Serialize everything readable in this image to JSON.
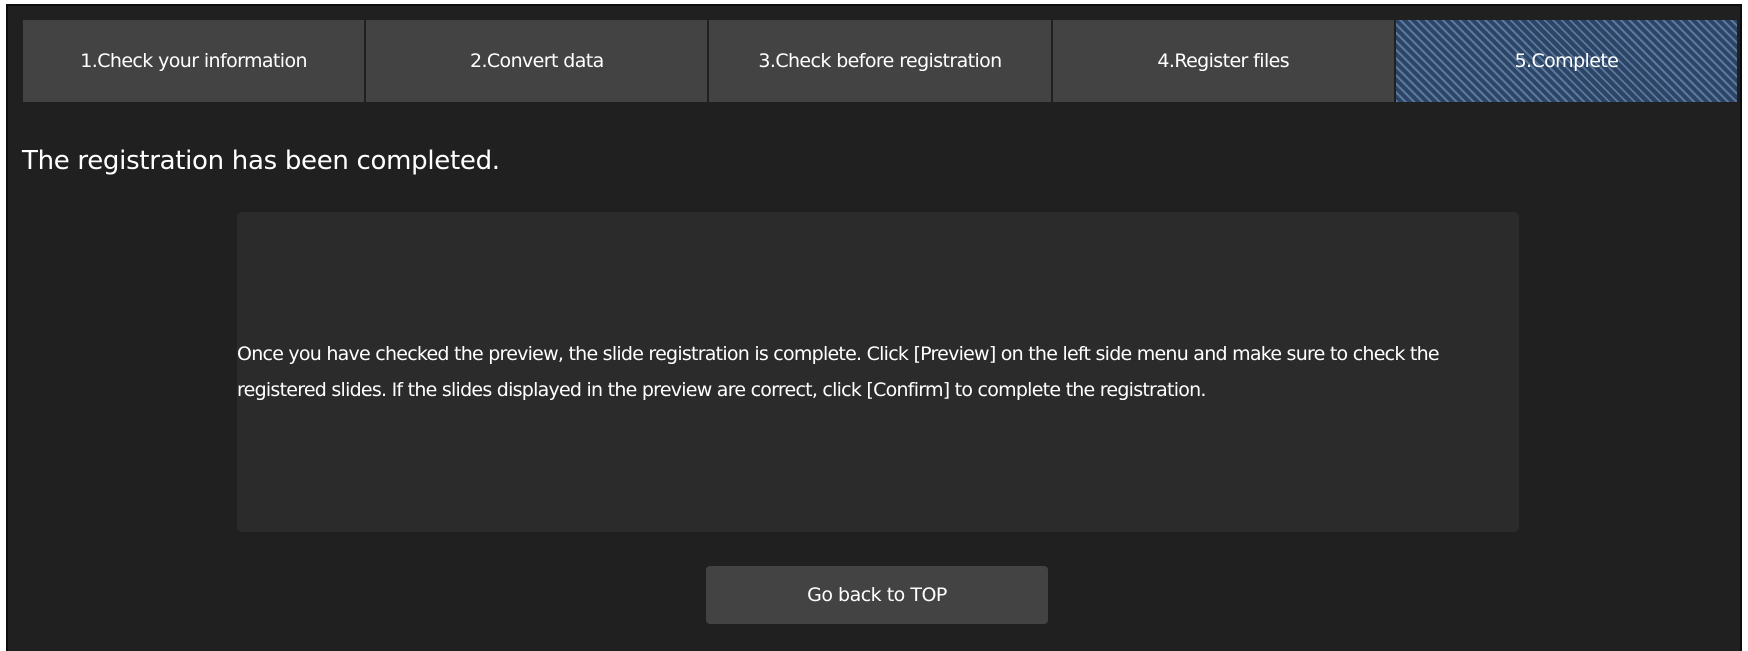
{
  "steps": [
    {
      "label": "1.Check your information",
      "active": false
    },
    {
      "label": "2.Convert data",
      "active": false
    },
    {
      "label": "3.Check before registration",
      "active": false
    },
    {
      "label": "4.Register files",
      "active": false
    },
    {
      "label": "5.Complete",
      "active": true
    }
  ],
  "page": {
    "title": "The registration has been completed.",
    "message": "Once you have checked the preview, the slide registration is complete. Click [Preview] on the left side menu and make sure to check the registered slides. If the slides displayed in the preview are correct, click [Confirm] to complete the registration.",
    "back_button_label": "Go back to TOP"
  },
  "colors": {
    "background": "#202020",
    "step_tab": "#434343",
    "step_active": "#3a5577",
    "message_box": "#2b2b2b",
    "button": "#434343",
    "text": "#ffffff"
  }
}
